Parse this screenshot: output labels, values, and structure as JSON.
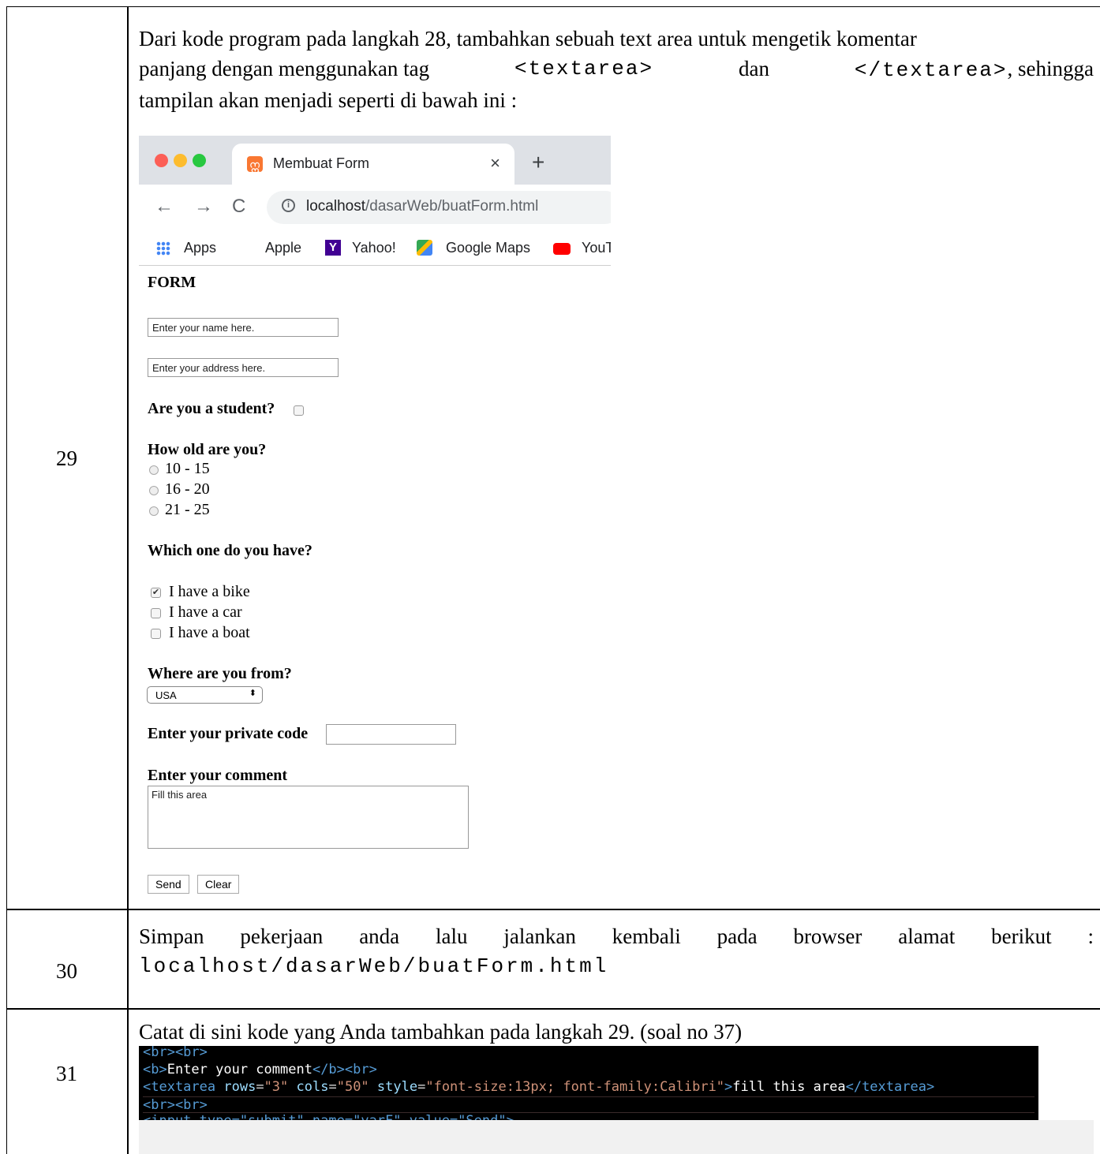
{
  "rows": [
    {
      "number": "29"
    },
    {
      "number": "30"
    },
    {
      "number": "31"
    }
  ],
  "step29": {
    "line1": "Dari kode program pada langkah 28, tambahkan sebuah text area untuk mengetik komentar",
    "line2_a": "panjang dengan menggunakan tag",
    "line2_tag1": "<textarea>",
    "line2_dan": "dan",
    "line2_tag2": "</textarea>",
    "line2_b": ", sehingga",
    "line3": "tampilan akan menjadi seperti di bawah ini :"
  },
  "browser": {
    "tab_title": "Membuat Form",
    "tab_close": "×",
    "new_tab": "+",
    "url_host": "localhost",
    "url_path": "/dasarWeb/buatForm.html",
    "bookmarks": [
      "Apps",
      "Apple",
      "Yahoo!",
      "Google Maps",
      "YouT"
    ],
    "colors": {
      "close": "#fc5f57",
      "min": "#fdbc2e",
      "max": "#28c840"
    }
  },
  "form": {
    "heading": "FORM",
    "name_value": "Enter your name here.",
    "address_value": "Enter your address here.",
    "student_label": "Are you a student?",
    "age_label": "How old are you?",
    "age_options": [
      "10 - 15",
      "16 - 20",
      "21 - 25"
    ],
    "have_label": "Which one do you have?",
    "have_options": [
      "I have a bike",
      "I have a car",
      "I have a boat"
    ],
    "from_label": "Where are you from?",
    "country": "USA",
    "private_label": "Enter your private code",
    "comment_label": "Enter your comment",
    "comment_value": "Fill this area",
    "send": "Send",
    "clear": "Clear"
  },
  "step30": {
    "text": "Simpan pekerjaan anda lalu jalankan kembali pada browser alamat berikut :",
    "url": "localhost/dasarWeb/buatForm.html"
  },
  "step31": {
    "text": "Catat di sini kode yang Anda tambahkan pada langkah 29. (soal no 37)",
    "code": {
      "l1": "<br><br>",
      "l2_open": "<b>",
      "l2_text": "Enter your comment",
      "l2_close": "</b><br>",
      "l3_open": "<textarea",
      "l3_a1": " rows",
      "l3_v1": "\"3\"",
      "l3_a2": " cols",
      "l3_v2": "\"50\"",
      "l3_a3": " style",
      "l3_v3": "\"font-size:13px; font-family:Calibri\"",
      "l3_text": "fill this area",
      "l3_close": "</textarea>",
      "l4": "<br><br>",
      "l5": "<input type=\"submit\" name=\"varF\" value=\"Send\">"
    }
  }
}
